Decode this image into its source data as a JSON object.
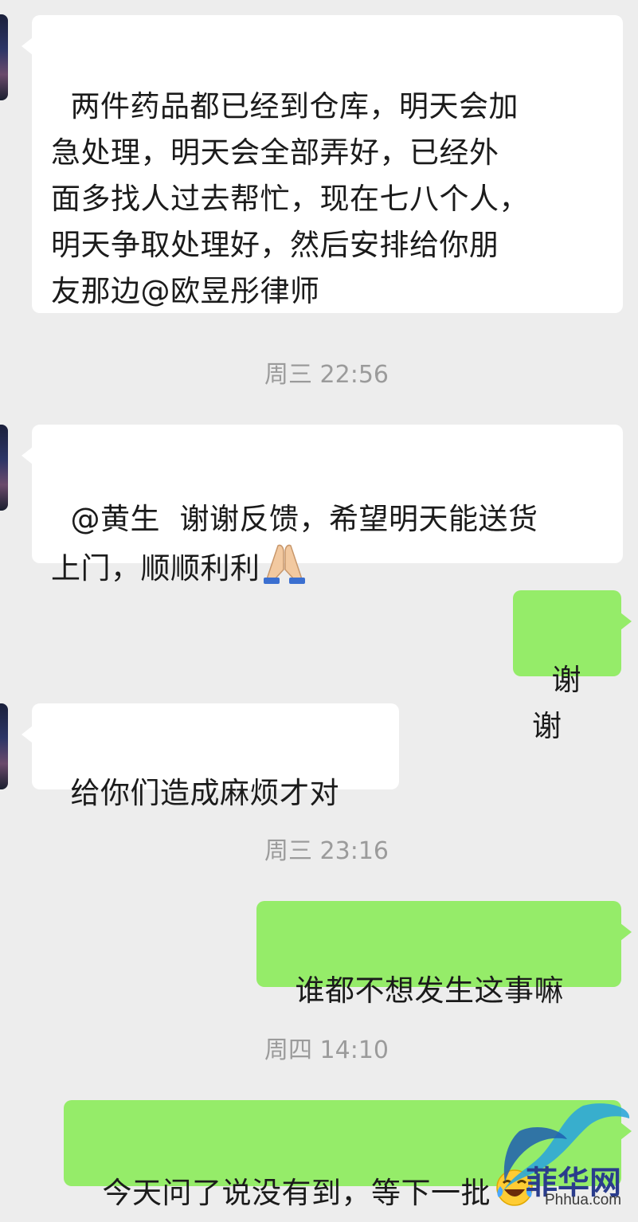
{
  "messages": [
    {
      "side": "in",
      "text": "两件药品都已经到仓库，明天会加\n急处理，明天会全部弄好，已经外\n面多找人过去帮忙，现在七八个人，\n明天争取处理好，然后安排给你朋\n友那边@欧昱彤律师"
    },
    {
      "text": "@黄生  谢谢反馈，希望明天能送货\n上门，顺顺利利",
      "emoji": "folded-hands-emoji"
    },
    {
      "text": "谢谢"
    },
    {
      "text": "给你们造成麻烦才对"
    },
    {
      "text": "谁都不想发生这事嘛"
    },
    {
      "text": "今天问了说没有到，等下一批",
      "emoji": "tears-of-joy-emoji"
    }
  ],
  "timestamps": [
    "周三 22:56",
    "周三 23:16",
    "周四 14:10"
  ],
  "colors": {
    "background": "#ededed",
    "incoming_bubble": "#ffffff",
    "outgoing_bubble": "#95ec69",
    "timestamp": "#9b9b9b"
  },
  "watermark": {
    "text": "菲华网",
    "url": "Phhua.com"
  }
}
